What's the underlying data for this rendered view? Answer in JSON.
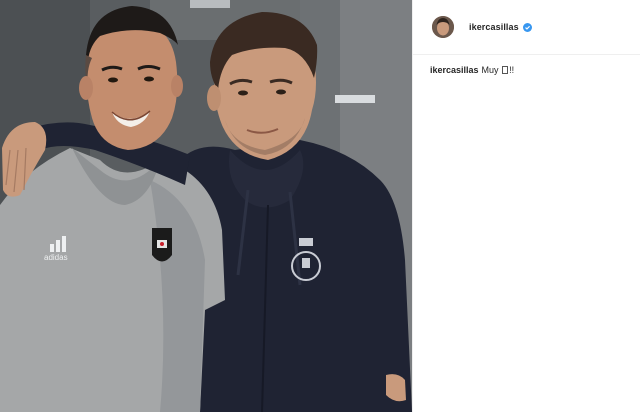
{
  "post": {
    "username": "ikercasillas",
    "verified": true,
    "caption_user": "ikercasillas",
    "caption_text_before": "Muy",
    "caption_emoji": "box-emoji-glyph",
    "caption_text_after": "!!"
  },
  "photo": {
    "jersey_brand": "adidas"
  },
  "colors": {
    "verified_blue": "#3897f0",
    "text": "#262626",
    "divider": "#efefef"
  },
  "icons": [
    "verified-badge-icon",
    "avatar"
  ]
}
